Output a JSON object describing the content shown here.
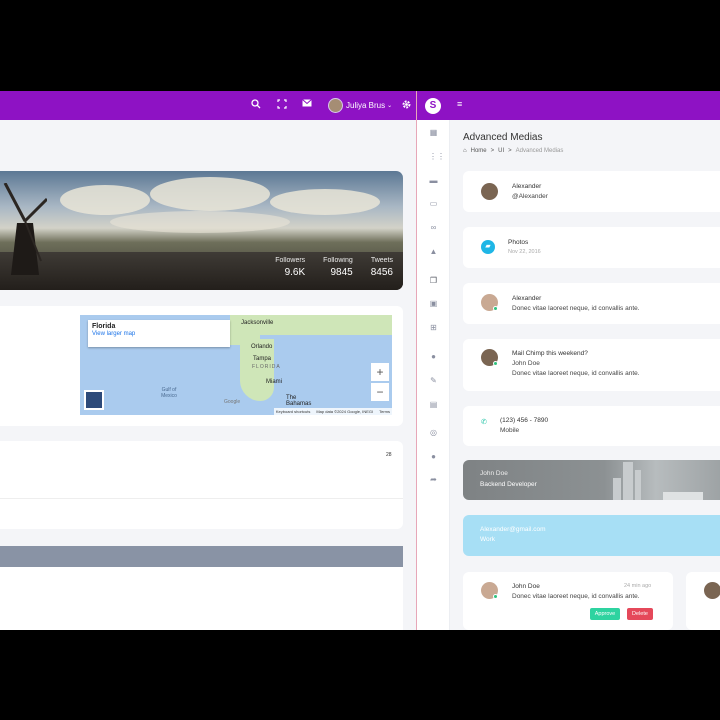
{
  "left": {
    "user_name": "Juliya Brus",
    "stats": [
      {
        "label": "Followers",
        "value": "9.6K"
      },
      {
        "label": "Following",
        "value": "9845"
      },
      {
        "label": "Tweets",
        "value": "8456"
      }
    ],
    "map": {
      "place": "Florida",
      "link": "View larger map",
      "labels": [
        "Jacksonville",
        "Orlando",
        "Tampa",
        "FLORIDA",
        "Miami",
        "Gulf of Mexico",
        "The Bahamas"
      ],
      "google": "Google",
      "footer": [
        "Keyboard shortcuts",
        "Map data ©2024 Google, INEGI",
        "Terms"
      ]
    },
    "small_number": "28"
  },
  "right": {
    "page_title": "Advanced Medias",
    "breadcrumb": {
      "home": "Home",
      "sep": ">",
      "level1": "UI",
      "current": "Advanced Medias"
    },
    "cards": {
      "c1": {
        "name": "Alexander",
        "handle": "@Alexander"
      },
      "c2": {
        "name": "Photos",
        "date": "Nov 22, 2016"
      },
      "c3": {
        "name": "Alexander",
        "text": "Donec vitae laoreet neque, id convallis ante."
      },
      "c4": {
        "title": "Mail Chimp this weekend?",
        "name": "John Doe",
        "text": "Donec vitae laoreet neque, id convallis ante."
      },
      "c5": {
        "phone": "(123) 456 - 7890",
        "type": "Mobile"
      },
      "c6": {
        "name": "John Doe",
        "role": "Backend Developer"
      },
      "c7": {
        "email": "Alexander@gmail.com",
        "type": "Work"
      },
      "c8": {
        "name": "John Doe",
        "time": "24 min ago",
        "text": "Donec vitae laoreet neque, id convallis ante.",
        "approve": "Approve",
        "delete": "Delete"
      }
    }
  },
  "colors": {
    "topbar": "#8e12c4",
    "approve": "#2ed3a0",
    "delete": "#e5485a",
    "email_card": "#a7dff5"
  },
  "icons": [
    "search-icon",
    "fullscreen-icon",
    "mail-icon",
    "gear-icon",
    "menu-icon",
    "logo-icon",
    "phone-icon",
    "folder-icon",
    "home-icon"
  ]
}
